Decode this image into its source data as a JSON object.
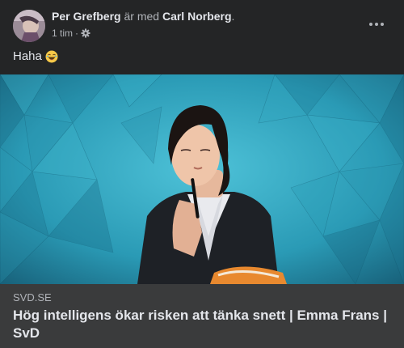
{
  "post": {
    "author": "Per Grefberg",
    "with_text": "är med",
    "tagged": "Carl Norberg",
    "period": ".",
    "time": "1 tim",
    "separator": "·",
    "body": "Haha",
    "icons": {
      "audience": "gear-icon",
      "menu": "more-icon",
      "emoji": "laughing-emoji-icon"
    }
  },
  "link_preview": {
    "domain": "SVD.SE",
    "title": "Hög intelligens ökar risken att tänka snett | Emma Frans | SvD"
  },
  "colors": {
    "background": "#242526",
    "preview_info_bg": "#3a3b3c",
    "primary_text": "#e4e6eb",
    "secondary_text": "#b0b3b8",
    "image_teal": "#2da3bd"
  }
}
